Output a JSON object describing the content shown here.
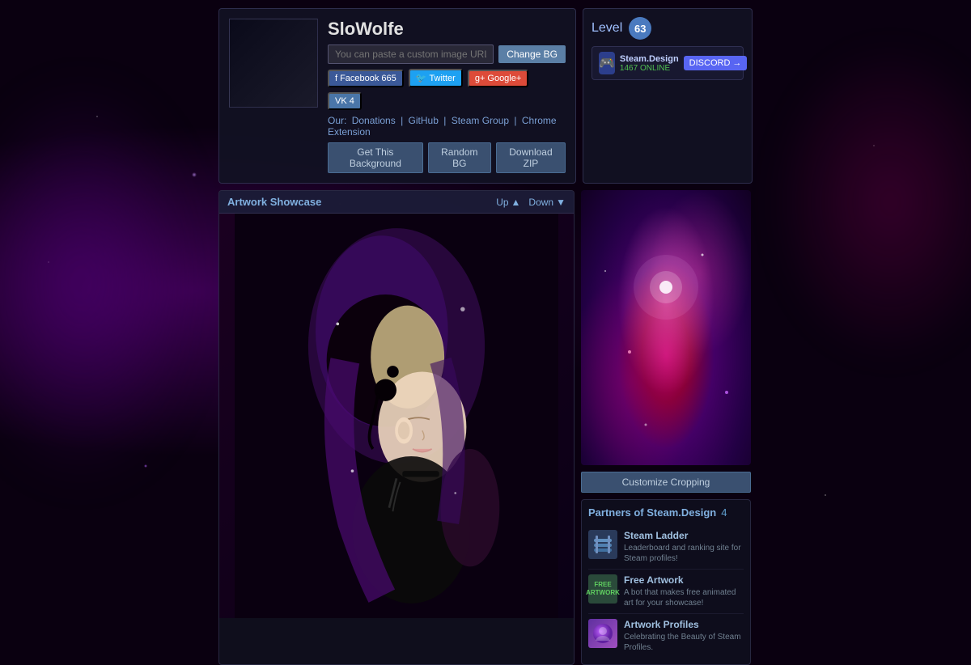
{
  "background": {
    "description": "Space nebula background, dark purple and pink"
  },
  "profile": {
    "username": "SloWolfe",
    "avatar_alt": "User avatar",
    "url_placeholder": "You can paste a custom image URL here...",
    "change_bg_label": "Change BG",
    "social": {
      "facebook_label": "Facebook",
      "facebook_count": "665",
      "twitter_label": "Twitter",
      "google_label": "Google+",
      "vk_label": "VK",
      "vk_count": "4"
    },
    "links": {
      "label": "Our:",
      "donations": "Donations",
      "github": "GitHub",
      "steam_group": "Steam Group",
      "chrome_extension": "Chrome Extension"
    },
    "actions": {
      "get_bg": "Get This Background",
      "random_bg": "Random BG",
      "download_zip": "Download ZIP"
    }
  },
  "level": {
    "label": "Level",
    "number": "63"
  },
  "discord": {
    "name": "Steam.Design",
    "status": "1467 ONLINE",
    "join_label": "DISCORD",
    "join_arrow": "→"
  },
  "customize": {
    "label": "Customize Cropping"
  },
  "showcase": {
    "title": "Artwork Showcase",
    "up_label": "Up",
    "down_label": "Down"
  },
  "partners": {
    "title": "Partners of Steam.Design",
    "count": "4",
    "items": [
      {
        "name": "Steam Ladder",
        "description": "Leaderboard and ranking site for Steam profiles!",
        "icon_type": "ladder"
      },
      {
        "name": "Free Artwork",
        "description": "A bot that makes free animated art for your showcase!",
        "icon_type": "freeart",
        "icon_text": "FREE\nARTWORK"
      },
      {
        "name": "Artwork Profiles",
        "description": "Celebrating the Beauty of Steam Profiles.",
        "icon_type": "profiles"
      }
    ]
  }
}
